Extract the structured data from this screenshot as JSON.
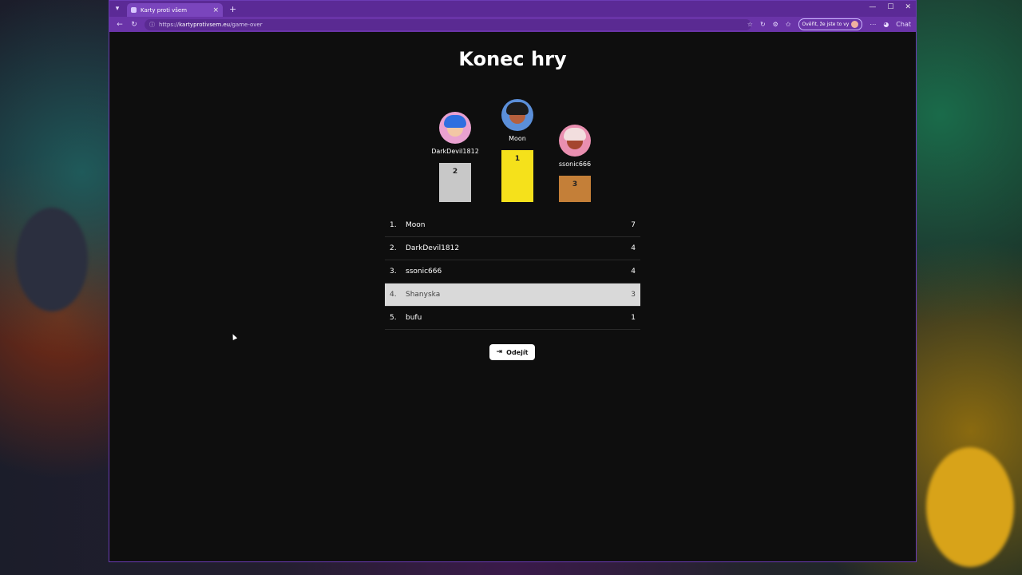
{
  "browser": {
    "tab_title": "Karty proti všem",
    "url_prefix": "https://",
    "url_host": "kartyprotivsem.eu",
    "url_path": "/game-over",
    "verify_label": "Ověřit, že jste to vy",
    "chat_label": "Chat",
    "new_tab_label": "+",
    "tab_close_label": "×"
  },
  "page": {
    "title": "Konec hry",
    "podium": [
      {
        "place": "2",
        "name": "DarkDevil1812",
        "color": "#c8c8c8",
        "avatar_bg": "#e9a1d0"
      },
      {
        "place": "1",
        "name": "Moon",
        "color": "#f5e11b",
        "avatar_bg": "#5b8fd9"
      },
      {
        "place": "3",
        "name": "ssonic666",
        "color": "#c47f38",
        "avatar_bg": "#e98fb0"
      }
    ],
    "ranking": [
      {
        "rank": "1.",
        "name": "Moon",
        "score": "7"
      },
      {
        "rank": "2.",
        "name": "DarkDevil1812",
        "score": "4"
      },
      {
        "rank": "3.",
        "name": "ssonic666",
        "score": "4"
      },
      {
        "rank": "4.",
        "name": "Shanyska",
        "score": "3"
      },
      {
        "rank": "5.",
        "name": "bufu",
        "score": "1"
      }
    ],
    "exit_label": "Odejít"
  }
}
